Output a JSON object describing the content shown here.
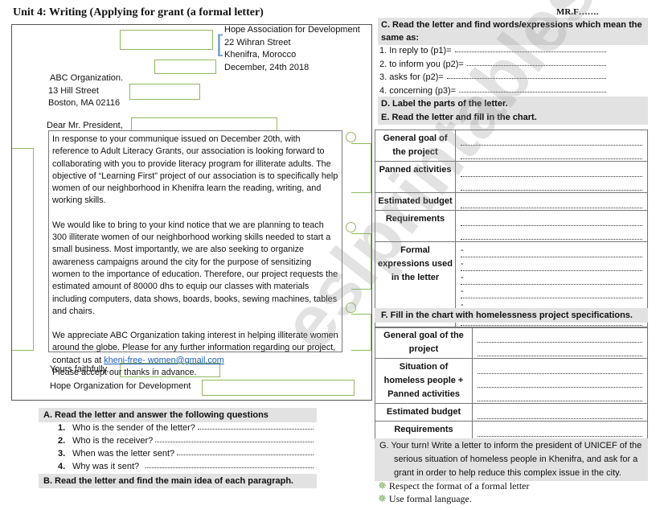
{
  "title": "Unit 4: Writing (Applying for grant (a formal letter)",
  "author": "MR.F…….",
  "letter": {
    "sender": [
      "Hope Association for Development",
      "22 Wihran Street",
      "Khenifra, Morocco"
    ],
    "date": "December, 24th  2018",
    "receiver": [
      "ABC Organization.",
      "13 Hill Street",
      "Boston, MA 02116"
    ],
    "salutation": "Dear Mr. President,",
    "paragraphs": [
      "In response to your communique issued on December 20th, with reference to Adult Literacy Grants, our association is looking forward to collaborating with you to provide literacy program for illiterate adults. The objective of “Learning First” project of our association is to specifically help women of our neighborhood in Khenifra learn the reading, writing, and working skills.",
      "We would like to bring to your kind notice that we are planning to teach 300 illiterate women of our neighborhood working skills needed to start a small business. Most importantly, we are also seeking to organize awareness campaigns around the city for the purpose of sensitizing women to the importance of education. Therefore, our project requests the estimated amount of 80000 dhs to equip our classes with materials including computers, data shows, boards, books, sewing machines, tables and chairs."
    ],
    "p3_text": "We appreciate ABC Organization taking interest in helping illiterate women around the globe. Please for any further information regarding our project, contact us at",
    "email": "kheni-free- women@gmail.com",
    "p3_end": "Please accept our thanks in advance.",
    "closing": "Yours faithfully,",
    "signature": "Hope Organization for Development"
  },
  "sectionA": {
    "heading": "A.   Read the letter and answer the following questions",
    "items": [
      {
        "n": "1.",
        "q": "Who is the sender of the letter?"
      },
      {
        "n": "2.",
        "q": "Who is the receiver?"
      },
      {
        "n": "3.",
        "q": "When was the letter sent?"
      },
      {
        "n": "4.",
        "q": "Why was it sent?"
      }
    ]
  },
  "sectionB": {
    "heading": "B.   Read the letter and find the main idea of each paragraph."
  },
  "sectionC": {
    "heading": "C. Read the letter and find words/expressions which mean the same as:",
    "items": [
      "1. In reply to (p1)=",
      "2. to inform you (p2)=",
      "3. asks for (p2)=",
      "4. concerning (p3)="
    ]
  },
  "sectionD": {
    "heading": "D. Label the parts of the letter."
  },
  "sectionE": {
    "heading": "E. Read the letter and fill in the chart.",
    "rows": [
      {
        "label": "General goal of the project",
        "lines": 2
      },
      {
        "label": "Panned activities",
        "lines": 2
      },
      {
        "label": "Estimated budget",
        "lines": 1
      },
      {
        "label": "Requirements",
        "lines": 2
      },
      {
        "label": "Formal expressions used in the letter",
        "lines": 6
      }
    ]
  },
  "sectionF": {
    "heading": "F.   Fill in the chart with homelessness project specifications.",
    "rows": [
      {
        "label": "General goal of the project",
        "lines": 2
      },
      {
        "label": "Situation of homeless people + Panned activities",
        "lines": 3
      },
      {
        "label": "Estimated budget",
        "lines": 1
      },
      {
        "label": "Requirements",
        "lines": 2
      }
    ]
  },
  "sectionG": {
    "heading": "G.   Your turn! Write a letter to inform the president of UNICEF of the serious situation of homeless people in Khenifra, and ask for a grant in order to help reduce this complex issue in the city.",
    "tips": [
      "Respect the format of a formal letter",
      "Use formal language."
    ]
  },
  "watermark": "eslprintables.com",
  "colors": {
    "label_box": "#8fba5c",
    "header_bg": "#e2e2e2",
    "brace": "#7aa0c8",
    "link": "#1f5fbf"
  }
}
